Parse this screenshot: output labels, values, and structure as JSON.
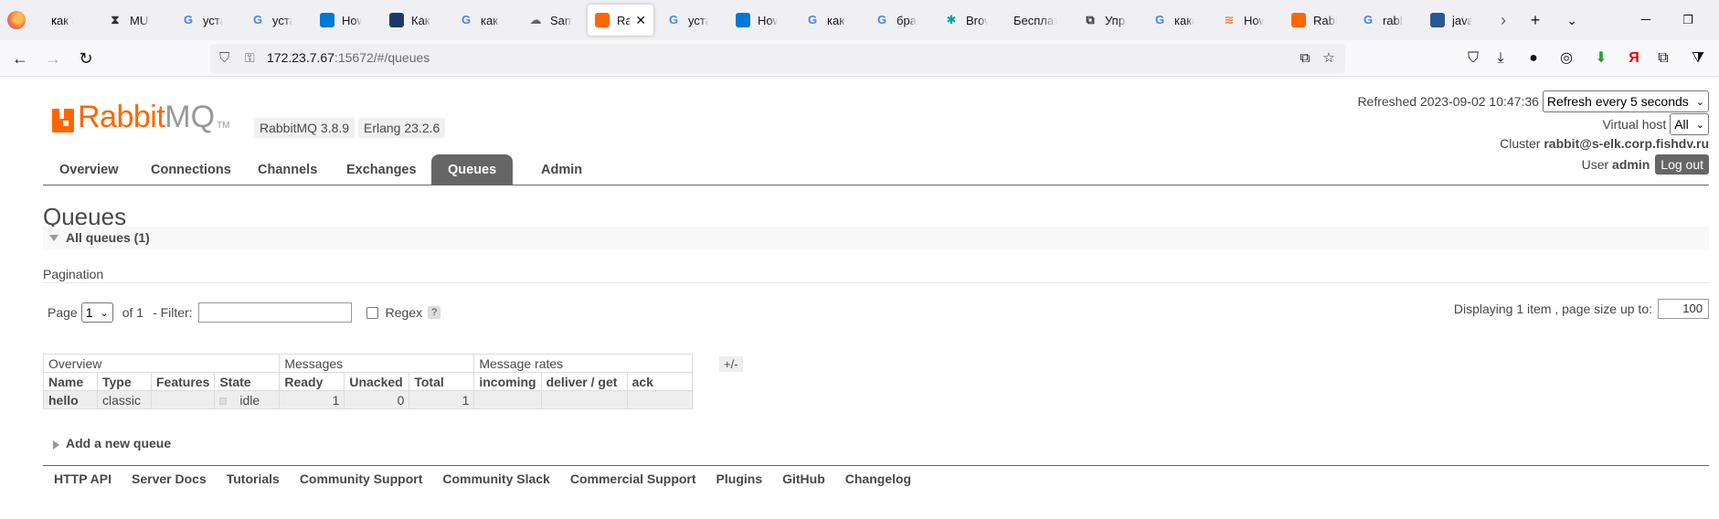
{
  "browser": {
    "tabs": [
      {
        "title": "как св",
        "icon": "back-arrow-icon"
      },
      {
        "title": "MUM",
        "icon": "hourglass-icon"
      },
      {
        "title": "устан",
        "icon": "google-icon"
      },
      {
        "title": "устан",
        "icon": "google-icon"
      },
      {
        "title": "How t",
        "icon": "docs-icon"
      },
      {
        "title": "Как ус",
        "icon": "site-icon"
      },
      {
        "title": "как по",
        "icon": "google-icon"
      },
      {
        "title": "Samb",
        "icon": "cloud-icon"
      },
      {
        "title": "Rab",
        "icon": "rabbitmq-icon",
        "active": true
      },
      {
        "title": "устан",
        "icon": "google-icon"
      },
      {
        "title": "How t",
        "icon": "docs-icon"
      },
      {
        "title": "как ус",
        "icon": "google-icon"
      },
      {
        "title": "брауз",
        "icon": "google-icon"
      },
      {
        "title": "Brows",
        "icon": "teal-icon"
      },
      {
        "title": "Бесплатн",
        "icon": "none"
      },
      {
        "title": "Управ",
        "icon": "puzzle-icon"
      },
      {
        "title": "кака в",
        "icon": "google-icon"
      },
      {
        "title": "How t",
        "icon": "stackoverflow-icon"
      },
      {
        "title": "Rabbit",
        "icon": "rabbitmq-icon"
      },
      {
        "title": "rabbit",
        "icon": "google-icon"
      },
      {
        "title": "java -",
        "icon": "java-icon"
      }
    ],
    "url_host": "172.23.7.67",
    "url_rest": ":15672/#/queues"
  },
  "header": {
    "logo_rabbit": "Rabbit",
    "logo_mq": "MQ",
    "logo_tm": "TM",
    "rabbitmq_version": "RabbitMQ 3.8.9",
    "erlang_version": "Erlang 23.2.6",
    "refreshed_label": "Refreshed 2023-09-02 10:47:36",
    "refresh_select": "Refresh every 5 seconds",
    "vhost_label": "Virtual host",
    "vhost_select": "All",
    "cluster_label": "Cluster",
    "cluster_name": "rabbit@s-elk.corp.fishdv.ru",
    "user_label": "User",
    "user_name": "admin",
    "logout_label": "Log out"
  },
  "nav": {
    "overview": "Overview",
    "connections": "Connections",
    "channels": "Channels",
    "exchanges": "Exchanges",
    "queues": "Queues",
    "admin": "Admin"
  },
  "main": {
    "title": "Queues",
    "section": "All queues (1)",
    "pagination_label": "Pagination",
    "page_label": "Page",
    "page_value": "1",
    "of_label": "of 1",
    "filter_label": "- Filter:",
    "regex_label": "Regex",
    "help_label": "?",
    "displaying_label": "Displaying 1 item , page size up to:",
    "page_size": "100",
    "plus_minus": "+/-",
    "add_queue": "Add a new queue"
  },
  "table": {
    "groups": [
      "Overview",
      "Messages",
      "Message rates"
    ],
    "columns": [
      "Name",
      "Type",
      "Features",
      "State",
      "Ready",
      "Unacked",
      "Total",
      "incoming",
      "deliver / get",
      "ack"
    ],
    "rows": [
      {
        "name": "hello",
        "type": "classic",
        "features": "",
        "state": "idle",
        "ready": "1",
        "unacked": "0",
        "total": "1",
        "incoming": "",
        "deliver_get": "",
        "ack": ""
      }
    ]
  },
  "footer": {
    "links": [
      "HTTP API",
      "Server Docs",
      "Tutorials",
      "Community Support",
      "Community Slack",
      "Commercial Support",
      "Plugins",
      "GitHub",
      "Changelog"
    ]
  }
}
